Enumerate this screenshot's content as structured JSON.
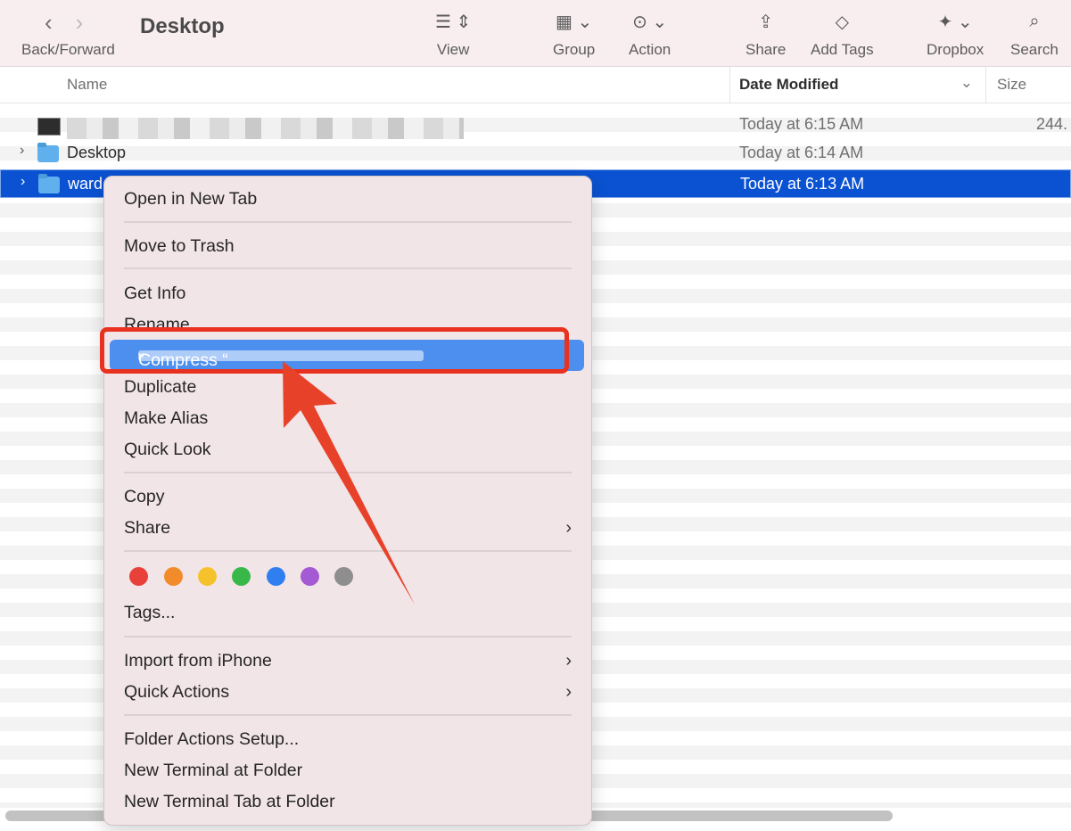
{
  "toolbar": {
    "title": "Desktop",
    "back_forward_label": "Back/Forward",
    "view_label": "View",
    "group_label": "Group",
    "action_label": "Action",
    "share_label": "Share",
    "add_tags_label": "Add Tags",
    "dropbox_label": "Dropbox",
    "search_label": "Search"
  },
  "columns": {
    "name": "Name",
    "date_modified": "Date Modified",
    "size": "Size"
  },
  "files": [
    {
      "name": "",
      "date": "Today at 6:15 AM",
      "size": "244."
    },
    {
      "name": "Desktop",
      "date": "Today at 6:14 AM",
      "size": ""
    },
    {
      "name": "ward",
      "date": "Today at 6:13 AM",
      "size": ""
    }
  ],
  "context_menu": {
    "open_new_tab": "Open in New Tab",
    "move_to_trash": "Move to Trash",
    "get_info": "Get Info",
    "rename": "Rename",
    "compress": "Compress “",
    "compress_end": "”",
    "duplicate": "Duplicate",
    "make_alias": "Make Alias",
    "quick_look": "Quick Look",
    "copy": "Copy",
    "share": "Share",
    "tags": "Tags...",
    "import_iphone": "Import from iPhone",
    "quick_actions": "Quick Actions",
    "folder_actions": "Folder Actions Setup...",
    "new_terminal": "New Terminal at Folder",
    "new_terminal_tab": "New Terminal Tab at Folder"
  },
  "tag_colors": [
    "#e8413a",
    "#f28b2c",
    "#f6c22c",
    "#39b84a",
    "#2f7ff1",
    "#a45ad2",
    "#8e8e8e"
  ]
}
